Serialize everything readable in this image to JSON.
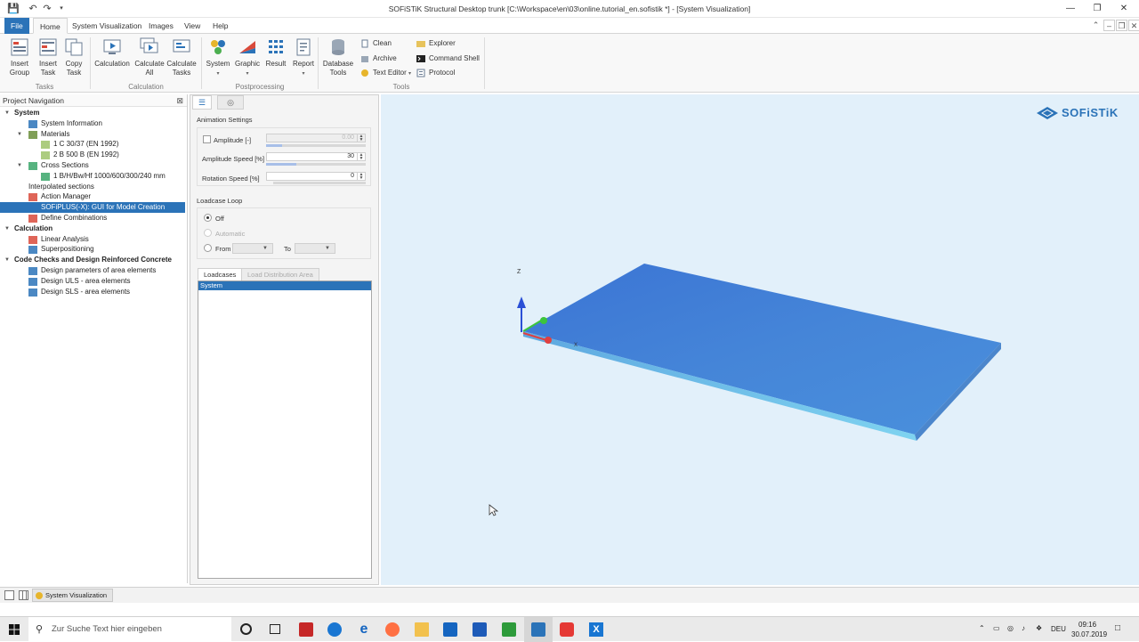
{
  "window": {
    "title": "SOFiSTiK Structural Desktop trunk  [C:\\Workspace\\en\\03\\online.tutorial_en.sofistik *] - [System Visualization]"
  },
  "menu": {
    "tabs": [
      "File",
      "Home",
      "System Visualization",
      "Images",
      "View",
      "Help"
    ]
  },
  "ribbon": {
    "tasks": {
      "insert_group": "Insert\nGroup",
      "insert_task": "Insert\nTask",
      "copy_task": "Copy\nTask",
      "group_label": "Tasks"
    },
    "calculation": {
      "calculation": "Calculation",
      "calculate_all": "Calculate\nAll",
      "calculate_tasks": "Calculate\nTasks",
      "group_label": "Calculation"
    },
    "postprocessing": {
      "system": "System",
      "graphic": "Graphic",
      "result": "Result",
      "report": "Report",
      "group_label": "Postprocessing"
    },
    "tools": {
      "database_tools": "Database\nTools",
      "clean": "Clean",
      "archive": "Archive",
      "text_editor": "Text Editor",
      "explorer": "Explorer",
      "command_shell": "Command Shell",
      "protocol": "Protocol",
      "group_label": "Tools"
    }
  },
  "navigation": {
    "header": "Project Navigation",
    "items": [
      {
        "label": "System",
        "bold": true
      },
      {
        "label": "System Information"
      },
      {
        "label": "Materials"
      },
      {
        "label": "1 C 30/37 (EN 1992)"
      },
      {
        "label": "2 B 500 B (EN 1992)"
      },
      {
        "label": "Cross Sections"
      },
      {
        "label": "1 B/H/Bw/Hf 1000/600/300/240 mm"
      },
      {
        "label": "Interpolated sections"
      },
      {
        "label": "Action Manager"
      },
      {
        "label": "SOFiPLUS(-X): GUI for Model Creation",
        "selected": true
      },
      {
        "label": "Define Combinations"
      },
      {
        "label": "Calculation",
        "bold": true
      },
      {
        "label": "Linear Analysis"
      },
      {
        "label": "Superpositioning"
      },
      {
        "label": "Code Checks and Design Reinforced Concrete",
        "bold": true
      },
      {
        "label": "Design parameters of area elements"
      },
      {
        "label": "Design ULS - area elements"
      },
      {
        "label": "Design SLS - area elements"
      }
    ]
  },
  "panel": {
    "animation_settings": "Animation Settings",
    "amplitude": {
      "label": "Amplitude [-]",
      "value": "0.00"
    },
    "amplitude_speed": {
      "label": "Amplitude Speed [%]",
      "value": "30",
      "level": 0.3
    },
    "rotation_speed": {
      "label": "Rotation Speed [%]",
      "value": "0",
      "level": 0
    },
    "loadcase_loop": "Loadcase Loop",
    "options": {
      "off": "Off",
      "automatic": "Automatic",
      "from": "From",
      "to": "To"
    },
    "tabs": {
      "loadcases": "Loadcases",
      "load_distribution": "Load Distribution Area"
    },
    "loadcase_list": [
      "System"
    ]
  },
  "viewport": {
    "logo": "SOFiSTiK",
    "axis_z": "Z",
    "axis_x": "X",
    "colors": {
      "background": "#e2f0fa",
      "slab": "#4a86d6",
      "accent": "#2b73b8"
    }
  },
  "status": {
    "tab": "System Visualization"
  },
  "taskbar": {
    "search_placeholder": "Zur Suche Text hier eingeben",
    "lang": "DEU",
    "time": "09:16",
    "date": "30.07.2019"
  }
}
